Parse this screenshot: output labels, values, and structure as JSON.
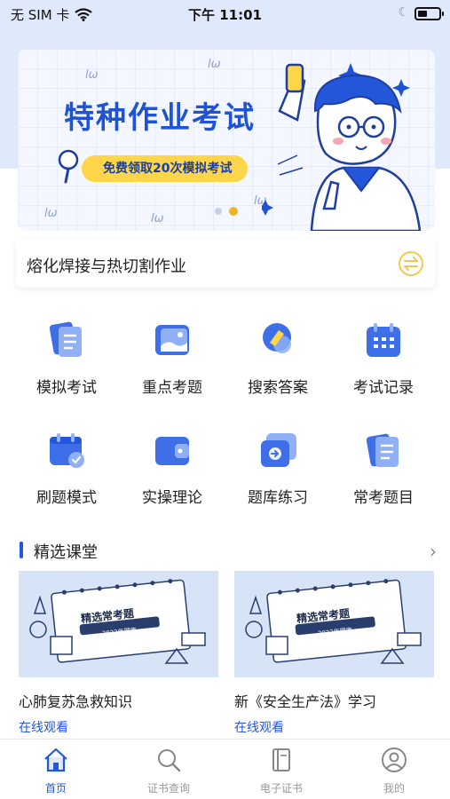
{
  "status_bar": {
    "carrier": "无 SIM 卡",
    "time": "下午 11:01",
    "wifi_icon": "wifi-icon",
    "moon_icon": "moon-icon",
    "battery_icon": "battery-icon"
  },
  "banner": {
    "title": "特种作业考试",
    "pill": "免费领取20次模拟考试",
    "active_dot": 1
  },
  "category": {
    "label": "熔化焊接与热切割作业",
    "icon": "swap-icon"
  },
  "grid": [
    {
      "label": "模拟考试",
      "icon": "document-icon"
    },
    {
      "label": "重点考题",
      "icon": "image-icon"
    },
    {
      "label": "搜索答案",
      "icon": "search-answer-icon"
    },
    {
      "label": "考试记录",
      "icon": "calendar-icon"
    },
    {
      "label": "刷题模式",
      "icon": "calendar-check-icon"
    },
    {
      "label": "实操理论",
      "icon": "wallet-icon"
    },
    {
      "label": "题库练习",
      "icon": "arrow-card-icon"
    },
    {
      "label": "常考题目",
      "icon": "list-document-icon"
    }
  ],
  "section": {
    "title": "精选课堂",
    "more_icon": "chevron-right-icon"
  },
  "courses": [
    {
      "title": "心肺复苏急救知识",
      "action": "在线观看",
      "thumb_caption": "精选常考题",
      "thumb_sub": "2022年题库"
    },
    {
      "title": "新《安全生产法》学习",
      "action": "在线观看",
      "thumb_caption": "精选常考题",
      "thumb_sub": "2022年题库"
    }
  ],
  "tabbar": [
    {
      "label": "首页",
      "icon": "home-icon",
      "active": true
    },
    {
      "label": "证书查询",
      "icon": "search-icon",
      "active": false
    },
    {
      "label": "电子证书",
      "icon": "book-icon",
      "active": false
    },
    {
      "label": "我的",
      "icon": "user-icon",
      "active": false
    }
  ],
  "colors": {
    "accent": "#2456d9",
    "banner_title": "#1f53d6",
    "pill": "#ffd54a",
    "top_background": "#dfe9fb"
  }
}
